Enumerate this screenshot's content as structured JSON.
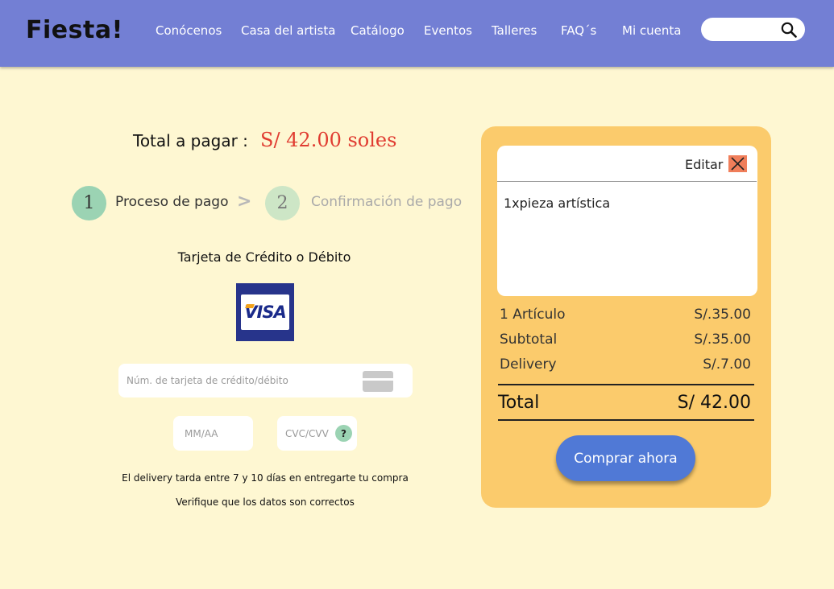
{
  "header": {
    "logo": "Fiesta!",
    "nav": [
      "Conócenos",
      "Casa del artista",
      "Catálogo",
      "Eventos",
      "Talleres",
      "FAQ´s",
      "Mi cuenta"
    ],
    "search": {
      "placeholder": "",
      "icon": "search-icon"
    }
  },
  "checkout": {
    "total_label": "Total a pagar :",
    "total_value": "S/ 42.00 soles",
    "steps": [
      {
        "number": "1",
        "label": "Proceso de pago",
        "active": true
      },
      {
        "number": "2",
        "label": "Confirmación de pago",
        "active": false
      }
    ],
    "step_separator": ">",
    "card_title": "Tarjeta de Crédito o Débito",
    "card_brand": "VISA",
    "fields": {
      "card_number_placeholder": "Núm. de tarjeta de crédito/débito",
      "expiry_placeholder": "MM/AA",
      "cvc_placeholder": "CVC/CVV",
      "help_symbol": "?"
    },
    "notes": [
      "El delivery tarda entre 7 y 10 días en entregarte tu compra",
      "Verifique que los datos son correctos"
    ]
  },
  "cart": {
    "edit_label": "Editar",
    "items": [
      "1xpieza artística"
    ],
    "summary": [
      {
        "label": "1 Artículo",
        "value": "S/.35.00"
      },
      {
        "label": "Subtotal",
        "value": "S/.35.00"
      },
      {
        "label": "Delivery",
        "value": "S/.7.00"
      }
    ],
    "total_label": "Total",
    "total_value": "S/ 42.00",
    "buy_label": "Comprar ahora"
  },
  "colors": {
    "header": "#737fd4",
    "background": "#fef7d2",
    "panel": "#fbcb6c",
    "price": "#e03c31",
    "buy_button": "#5079d6",
    "step_active": "#9bd3b3",
    "close": "#f07e5a"
  }
}
